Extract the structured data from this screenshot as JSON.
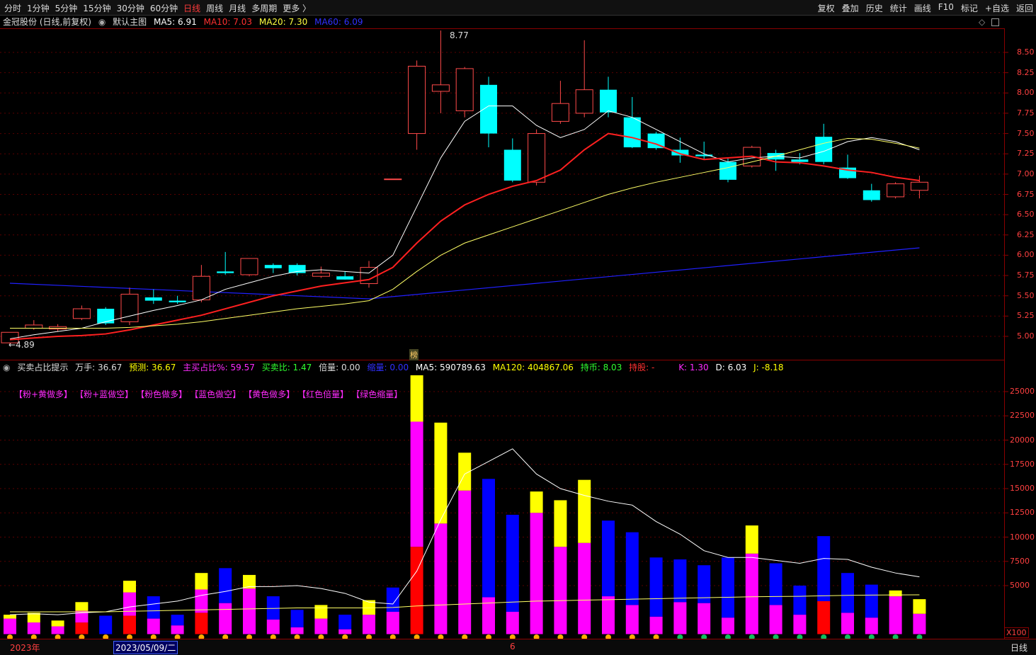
{
  "toolbar": {
    "left": [
      "分时",
      "1分钟",
      "5分钟",
      "15分钟",
      "30分钟",
      "60分钟",
      "日线",
      "周线",
      "月线",
      "多周期",
      "更多 〉"
    ],
    "active": "日线",
    "right": [
      "复权",
      "叠加",
      "历史",
      "统计",
      "画线",
      "F10",
      "标记",
      "+自选",
      "返回"
    ]
  },
  "main_info": {
    "stock": "金冠股份 (日线,前复权)",
    "indicator": "默认主图",
    "ma5": "MA5: 6.91",
    "ma10": "MA10: 7.03",
    "ma20": "MA20: 7.30",
    "ma60": "MA60: 6.09"
  },
  "sub_info": {
    "name": "买卖占比提示",
    "wanshou": "万手: 36.67",
    "yuce": "预测: 36.67",
    "zhumai": "主买占比%: 59.57",
    "maimai": "买卖比: 1.47",
    "beiliang": "倍量: 0.00",
    "suoliang": "缩量: 0.00",
    "ma5": "MA5: 590789.63",
    "ma120": "MA120: 404867.06",
    "chibi": "持币: 8.03",
    "chigu": "持股: -",
    "k": "K: 1.30",
    "d": "D: 6.03",
    "j": "J: -8.18"
  },
  "legend": [
    "【粉+黄做多】",
    "【粉+蓝做空】",
    "【粉色做多】",
    "【蓝色做空】",
    "【黄色做多】",
    "【红色倍量】",
    "【绿色缩量】"
  ],
  "bottom": {
    "year": "2023年",
    "date": "2023/05/09/二",
    "mark": "6",
    "period": "日线",
    "x100": "X100"
  },
  "annotations": {
    "high": "8.77",
    "low": "4.89",
    "bang": "榜"
  },
  "chart_data": [
    {
      "type": "candlestick",
      "title": "",
      "ylim": [
        4.8,
        8.9
      ],
      "yticks": [
        "8.50",
        "8.25",
        "8.00",
        "7.75",
        "7.50",
        "7.25",
        "7.00",
        "6.75",
        "6.50",
        "6.25",
        "6.00",
        "5.75",
        "5.50",
        "5.25",
        "5.00"
      ],
      "candles": [
        {
          "o": 4.92,
          "h": 5.05,
          "l": 4.89,
          "c": 5.05,
          "up": true
        },
        {
          "o": 5.1,
          "h": 5.2,
          "l": 5.08,
          "c": 5.14,
          "up": true
        },
        {
          "o": 5.09,
          "h": 5.15,
          "l": 5.06,
          "c": 5.12,
          "up": true
        },
        {
          "o": 5.22,
          "h": 5.38,
          "l": 5.2,
          "c": 5.34,
          "up": true
        },
        {
          "o": 5.34,
          "h": 5.36,
          "l": 5.14,
          "c": 5.16,
          "up": false
        },
        {
          "o": 5.18,
          "h": 5.6,
          "l": 5.14,
          "c": 5.52,
          "up": true
        },
        {
          "o": 5.48,
          "h": 5.58,
          "l": 5.4,
          "c": 5.44,
          "up": false
        },
        {
          "o": 5.44,
          "h": 5.5,
          "l": 5.4,
          "c": 5.42,
          "up": false
        },
        {
          "o": 5.45,
          "h": 5.88,
          "l": 5.42,
          "c": 5.74,
          "up": true
        },
        {
          "o": 5.8,
          "h": 6.04,
          "l": 5.76,
          "c": 5.78,
          "up": false
        },
        {
          "o": 5.76,
          "h": 5.96,
          "l": 5.74,
          "c": 5.96,
          "up": true
        },
        {
          "o": 5.88,
          "h": 5.9,
          "l": 5.78,
          "c": 5.84,
          "up": false
        },
        {
          "o": 5.88,
          "h": 5.9,
          "l": 5.75,
          "c": 5.78,
          "up": false
        },
        {
          "o": 5.74,
          "h": 5.86,
          "l": 5.72,
          "c": 5.78,
          "up": true
        },
        {
          "o": 5.74,
          "h": 5.8,
          "l": 5.7,
          "c": 5.7,
          "up": false
        },
        {
          "o": 5.65,
          "h": 5.93,
          "l": 5.6,
          "c": 5.85,
          "up": true
        },
        {
          "o": 6.94,
          "h": 6.94,
          "l": 6.94,
          "c": 6.94,
          "up": true
        },
        {
          "o": 7.5,
          "h": 8.4,
          "l": 7.3,
          "c": 8.33,
          "up": true
        },
        {
          "o": 8.02,
          "h": 8.77,
          "l": 7.75,
          "c": 8.1,
          "up": true
        },
        {
          "o": 7.78,
          "h": 8.32,
          "l": 7.7,
          "c": 8.3,
          "up": true
        },
        {
          "o": 8.1,
          "h": 8.2,
          "l": 7.33,
          "c": 7.5,
          "up": false
        },
        {
          "o": 7.3,
          "h": 7.44,
          "l": 6.9,
          "c": 6.92,
          "up": false
        },
        {
          "o": 6.9,
          "h": 7.55,
          "l": 6.86,
          "c": 7.5,
          "up": true
        },
        {
          "o": 7.65,
          "h": 8.15,
          "l": 7.62,
          "c": 7.87,
          "up": true
        },
        {
          "o": 7.75,
          "h": 8.65,
          "l": 7.7,
          "c": 8.04,
          "up": true
        },
        {
          "o": 8.04,
          "h": 8.2,
          "l": 7.7,
          "c": 7.76,
          "up": false
        },
        {
          "o": 7.7,
          "h": 7.95,
          "l": 7.32,
          "c": 7.33,
          "up": false
        },
        {
          "o": 7.5,
          "h": 7.52,
          "l": 7.3,
          "c": 7.32,
          "up": false
        },
        {
          "o": 7.3,
          "h": 7.45,
          "l": 7.14,
          "c": 7.23,
          "up": false
        },
        {
          "o": 7.24,
          "h": 7.4,
          "l": 7.18,
          "c": 7.22,
          "up": false
        },
        {
          "o": 7.15,
          "h": 7.2,
          "l": 6.9,
          "c": 6.93,
          "up": false
        },
        {
          "o": 7.1,
          "h": 7.35,
          "l": 7.08,
          "c": 7.33,
          "up": true
        },
        {
          "o": 7.26,
          "h": 7.3,
          "l": 7.04,
          "c": 7.18,
          "up": false
        },
        {
          "o": 7.18,
          "h": 7.26,
          "l": 7.12,
          "c": 7.15,
          "up": false
        },
        {
          "o": 7.46,
          "h": 7.62,
          "l": 7.12,
          "c": 7.15,
          "up": false
        },
        {
          "o": 7.08,
          "h": 7.24,
          "l": 6.94,
          "c": 6.95,
          "up": false
        },
        {
          "o": 6.8,
          "h": 6.88,
          "l": 6.66,
          "c": 6.68,
          "up": false
        },
        {
          "o": 6.72,
          "h": 6.9,
          "l": 6.7,
          "c": 6.88,
          "up": true
        },
        {
          "o": 6.8,
          "h": 6.98,
          "l": 6.7,
          "c": 6.9,
          "up": true
        }
      ],
      "ma5": [
        4.97,
        5.02,
        5.06,
        5.1,
        5.18,
        5.25,
        5.32,
        5.38,
        5.45,
        5.58,
        5.66,
        5.74,
        5.8,
        5.82,
        5.8,
        5.78,
        6.0,
        6.6,
        7.2,
        7.65,
        7.84,
        7.84,
        7.6,
        7.45,
        7.55,
        7.78,
        7.7,
        7.55,
        7.4,
        7.25,
        7.15,
        7.2,
        7.22,
        7.2,
        7.28,
        7.4,
        7.45,
        7.4,
        7.3
      ],
      "ma10": [
        4.96,
        4.98,
        5.0,
        5.01,
        5.03,
        5.08,
        5.14,
        5.2,
        5.26,
        5.34,
        5.42,
        5.5,
        5.56,
        5.62,
        5.66,
        5.7,
        5.85,
        6.15,
        6.42,
        6.62,
        6.75,
        6.85,
        6.92,
        7.05,
        7.3,
        7.5,
        7.45,
        7.37,
        7.25,
        7.18,
        7.2,
        7.22,
        7.15,
        7.14,
        7.1,
        7.05,
        7.02,
        6.96,
        6.92
      ]
    },
    {
      "type": "bar",
      "title": "",
      "ylim": [
        0,
        27500
      ],
      "yticks": [
        "25000",
        "22500",
        "20000",
        "17500",
        "15000",
        "12500",
        "10000",
        "7500",
        "5000"
      ],
      "stacks": [
        [
          [
            1600,
            "magenta"
          ],
          [
            400,
            "yellow"
          ]
        ],
        [
          [
            1200,
            "magenta"
          ],
          [
            1000,
            "yellow"
          ]
        ],
        [
          [
            800,
            "magenta"
          ],
          [
            600,
            "yellow"
          ]
        ],
        [
          [
            1200,
            "red"
          ],
          [
            1200,
            "magenta"
          ],
          [
            900,
            "yellow"
          ]
        ],
        [
          [
            0,
            "magenta"
          ],
          [
            1900,
            "blue"
          ]
        ],
        [
          [
            1900,
            "red"
          ],
          [
            2400,
            "magenta"
          ],
          [
            1200,
            "yellow"
          ]
        ],
        [
          [
            1600,
            "magenta"
          ],
          [
            2300,
            "blue"
          ]
        ],
        [
          [
            900,
            "magenta"
          ],
          [
            1100,
            "blue"
          ]
        ],
        [
          [
            2200,
            "red"
          ],
          [
            2400,
            "magenta"
          ],
          [
            1700,
            "yellow"
          ]
        ],
        [
          [
            3200,
            "magenta"
          ],
          [
            3600,
            "blue"
          ]
        ],
        [
          [
            4700,
            "magenta"
          ],
          [
            1400,
            "yellow"
          ]
        ],
        [
          [
            1500,
            "magenta"
          ],
          [
            2400,
            "blue"
          ]
        ],
        [
          [
            700,
            "magenta"
          ],
          [
            1800,
            "blue"
          ]
        ],
        [
          [
            1600,
            "magenta"
          ],
          [
            1400,
            "yellow"
          ]
        ],
        [
          [
            500,
            "magenta"
          ],
          [
            1500,
            "blue"
          ]
        ],
        [
          [
            2000,
            "magenta"
          ],
          [
            1500,
            "yellow"
          ]
        ],
        [
          [
            2300,
            "magenta"
          ],
          [
            2500,
            "blue"
          ]
        ],
        [
          [
            9000,
            "red"
          ],
          [
            12900,
            "magenta"
          ],
          [
            4800,
            "yellow"
          ]
        ],
        [
          [
            11400,
            "magenta"
          ],
          [
            10400,
            "yellow"
          ]
        ],
        [
          [
            14800,
            "magenta"
          ],
          [
            3900,
            "yellow"
          ]
        ],
        [
          [
            3800,
            "magenta"
          ],
          [
            12200,
            "blue"
          ]
        ],
        [
          [
            2300,
            "magenta"
          ],
          [
            10000,
            "blue"
          ]
        ],
        [
          [
            12500,
            "magenta"
          ],
          [
            2200,
            "yellow"
          ]
        ],
        [
          [
            9000,
            "magenta"
          ],
          [
            4800,
            "yellow"
          ]
        ],
        [
          [
            9400,
            "magenta"
          ],
          [
            6500,
            "yellow"
          ]
        ],
        [
          [
            3900,
            "magenta"
          ],
          [
            7800,
            "blue"
          ]
        ],
        [
          [
            3000,
            "magenta"
          ],
          [
            7500,
            "blue"
          ]
        ],
        [
          [
            1800,
            "magenta"
          ],
          [
            6100,
            "blue"
          ]
        ],
        [
          [
            3300,
            "magenta"
          ],
          [
            4400,
            "blue"
          ]
        ],
        [
          [
            3200,
            "magenta"
          ],
          [
            3900,
            "blue"
          ]
        ],
        [
          [
            1700,
            "magenta"
          ],
          [
            6200,
            "blue"
          ]
        ],
        [
          [
            8300,
            "magenta"
          ],
          [
            2900,
            "yellow"
          ]
        ],
        [
          [
            3000,
            "magenta"
          ],
          [
            4300,
            "blue"
          ]
        ],
        [
          [
            2000,
            "magenta"
          ],
          [
            3000,
            "blue"
          ]
        ],
        [
          [
            3400,
            "red"
          ],
          [
            6700,
            "blue"
          ]
        ],
        [
          [
            2200,
            "magenta"
          ],
          [
            4100,
            "blue"
          ]
        ],
        [
          [
            1700,
            "magenta"
          ],
          [
            3400,
            "blue"
          ]
        ],
        [
          [
            3900,
            "magenta"
          ],
          [
            600,
            "yellow"
          ]
        ],
        [
          [
            2100,
            "magenta"
          ],
          [
            1500,
            "yellow"
          ]
        ]
      ],
      "ma5": [
        2000,
        2100,
        2000,
        2200,
        2300,
        2800,
        3100,
        3400,
        4000,
        4400,
        4900,
        4900,
        5000,
        4700,
        4200,
        3300,
        3100,
        6500,
        11800,
        16500,
        17800,
        19100,
        16500,
        15000,
        14300,
        13700,
        13300,
        11600,
        10300,
        8600,
        7900,
        7900,
        7600,
        7300,
        7800,
        7700,
        6900,
        6300,
        5900
      ],
      "ma120": [
        2300,
        2300,
        2300,
        2300,
        2300,
        2350,
        2400,
        2450,
        2500,
        2550,
        2600,
        2650,
        2700,
        2700,
        2700,
        2700,
        2750,
        2900,
        3000,
        3100,
        3200,
        3300,
        3400,
        3450,
        3500,
        3550,
        3600,
        3650,
        3700,
        3750,
        3800,
        3850,
        3880,
        3900,
        3950,
        4000,
        4020,
        4040,
        4050
      ]
    }
  ]
}
